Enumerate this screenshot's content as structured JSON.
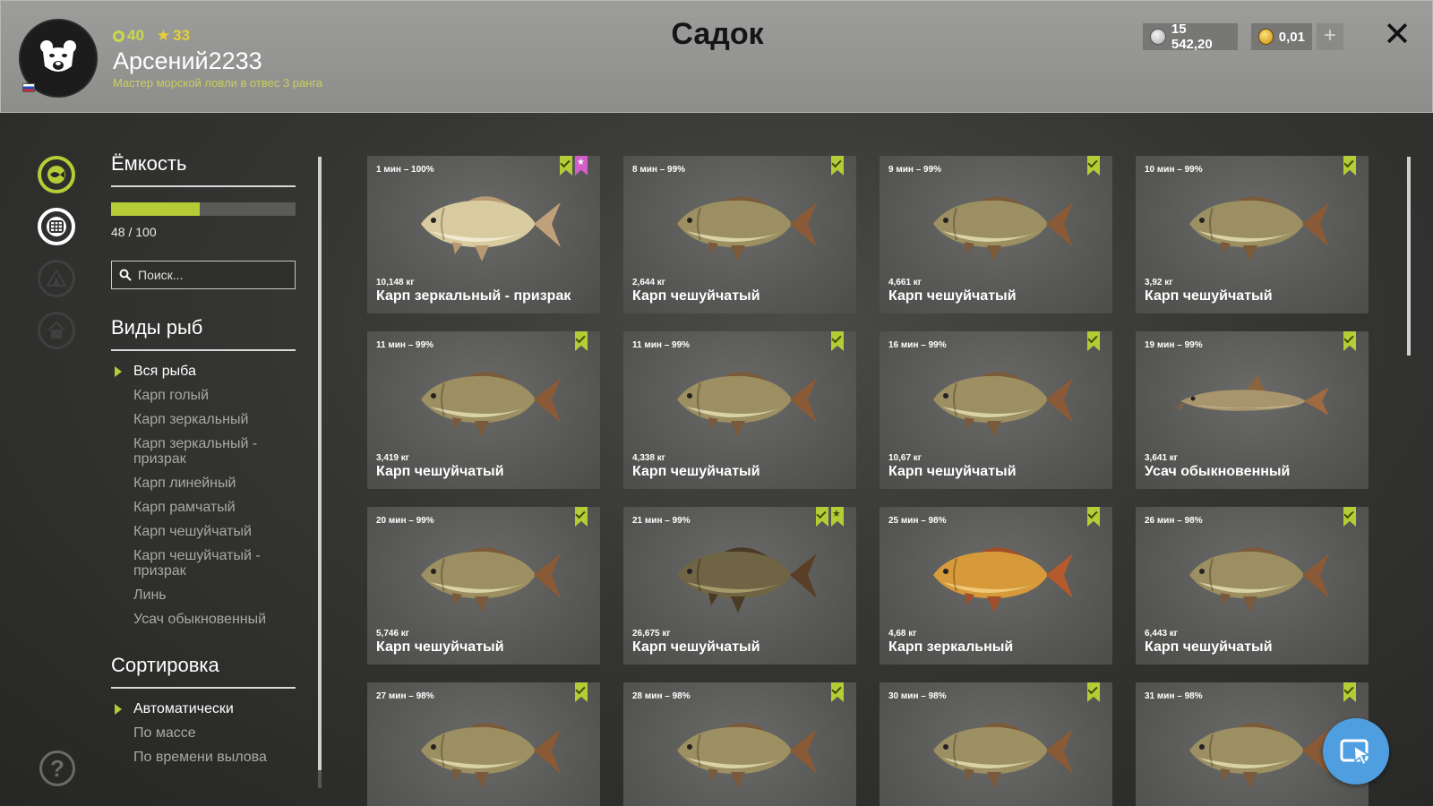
{
  "header": {
    "title": "Садок",
    "username": "Арсений2233",
    "user_title": "Мастер морской ловли в отвес 3 ранга",
    "level": "40",
    "stars": "33",
    "silver": "15 542,20",
    "gold": "0,01",
    "plus": "+",
    "close": "✕"
  },
  "capacity": {
    "title": "Ёмкость",
    "value_text": "48 / 100",
    "fraction": 0.48
  },
  "search": {
    "placeholder": "Поиск..."
  },
  "species": {
    "title": "Виды рыб",
    "items": [
      "Вся рыба",
      "Карп голый",
      "Карп зеркальный",
      "Карп зеркальный - призрак",
      "Карп линейный",
      "Карп рамчатый",
      "Карп чешуйчатый",
      "Карп чешуйчатый - призрак",
      "Линь",
      "Усач обыкновенный"
    ]
  },
  "sort": {
    "title": "Сортировка",
    "items": [
      "Автоматически",
      "По массе",
      "По времени вылова"
    ]
  },
  "help": "?",
  "colors": {
    "accent": "#b6cc36",
    "float_button": "#4f9fe0",
    "favorite": "#d15ec9"
  },
  "fish": [
    {
      "time": "1 мин – 100%",
      "weight": "10,148 кг",
      "name": "Карп зеркальный - призрак",
      "marks": [
        "check",
        "pink"
      ],
      "kind": "ghost"
    },
    {
      "time": "8 мин – 99%",
      "weight": "2,644 кг",
      "name": "Карп чешуйчатый",
      "marks": [
        "check"
      ],
      "kind": "common"
    },
    {
      "time": "9 мин – 99%",
      "weight": "4,661 кг",
      "name": "Карп чешуйчатый",
      "marks": [
        "check"
      ],
      "kind": "common"
    },
    {
      "time": "10 мин – 99%",
      "weight": "3,92 кг",
      "name": "Карп чешуйчатый",
      "marks": [
        "check"
      ],
      "kind": "common"
    },
    {
      "time": "11 мин – 99%",
      "weight": "3,419 кг",
      "name": "Карп чешуйчатый",
      "marks": [
        "check"
      ],
      "kind": "common"
    },
    {
      "time": "11 мин – 99%",
      "weight": "4,338 кг",
      "name": "Карп чешуйчатый",
      "marks": [
        "check"
      ],
      "kind": "common"
    },
    {
      "time": "16 мин – 99%",
      "weight": "10,67 кг",
      "name": "Карп чешуйчатый",
      "marks": [
        "check"
      ],
      "kind": "common"
    },
    {
      "time": "19 мин – 99%",
      "weight": "3,641 кг",
      "name": "Усач обыкновенный",
      "marks": [
        "check"
      ],
      "kind": "barbel"
    },
    {
      "time": "20 мин – 99%",
      "weight": "5,746 кг",
      "name": "Карп чешуйчатый",
      "marks": [
        "check"
      ],
      "kind": "common"
    },
    {
      "time": "21 мин – 99%",
      "weight": "26,675 кг",
      "name": "Карп чешуйчатый",
      "marks": [
        "check",
        "star"
      ],
      "kind": "dark"
    },
    {
      "time": "25 мин – 98%",
      "weight": "4,68 кг",
      "name": "Карп зеркальный",
      "marks": [
        "check"
      ],
      "kind": "mirror"
    },
    {
      "time": "26 мин – 98%",
      "weight": "6,443 кг",
      "name": "Карп чешуйчатый",
      "marks": [
        "check"
      ],
      "kind": "common"
    },
    {
      "time": "27 мин – 98%",
      "weight": "",
      "name": "",
      "marks": [
        "check"
      ],
      "kind": "common"
    },
    {
      "time": "28 мин – 98%",
      "weight": "",
      "name": "",
      "marks": [
        "check"
      ],
      "kind": "common"
    },
    {
      "time": "30 мин – 98%",
      "weight": "",
      "name": "",
      "marks": [
        "check"
      ],
      "kind": "common"
    },
    {
      "time": "31 мин – 98%",
      "weight": "",
      "name": "",
      "marks": [
        "check"
      ],
      "kind": "common"
    }
  ]
}
